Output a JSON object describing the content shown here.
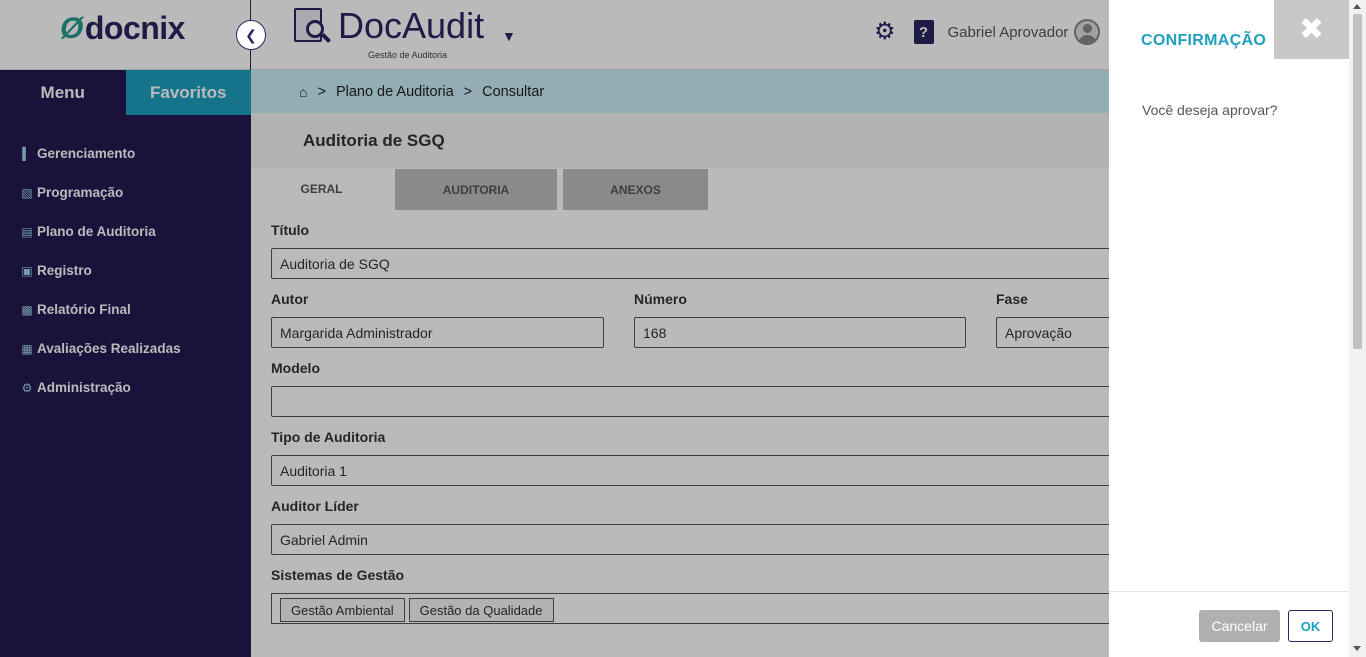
{
  "header": {
    "logo_text": "docnix",
    "app_name": "DocAudit",
    "app_subtitle": "Gestão de Auditoria",
    "user_name": "Gabriel Aprovador"
  },
  "sidebar": {
    "tabs": [
      {
        "label": "Menu"
      },
      {
        "label": "Favoritos"
      }
    ],
    "items": [
      {
        "label": "Gerenciamento",
        "icon": "bar-chart-icon"
      },
      {
        "label": "Programação",
        "icon": "calendar-icon"
      },
      {
        "label": "Plano de Auditoria",
        "icon": "document-icon"
      },
      {
        "label": "Registro",
        "icon": "register-icon"
      },
      {
        "label": "Relatório Final",
        "icon": "report-icon"
      },
      {
        "label": "Avaliações Realizadas",
        "icon": "evaluation-icon"
      },
      {
        "label": "Administração",
        "icon": "cog-icon"
      }
    ]
  },
  "breadcrumb": {
    "items": [
      "Plano de Auditoria",
      "Consultar"
    ],
    "separator": ">"
  },
  "page": {
    "title": "Auditoria de SGQ",
    "tabs": [
      "GERAL",
      "AUDITORIA",
      "ANEXOS"
    ]
  },
  "form": {
    "titulo_label": "Título",
    "titulo_value": "Auditoria de SGQ",
    "autor_label": "Autor",
    "autor_value": "Margarida Administrador",
    "numero_label": "Número",
    "numero_value": "168",
    "fase_label": "Fase",
    "fase_value": "Aprovação",
    "modelo_label": "Modelo",
    "modelo_value": "",
    "tipo_label": "Tipo de Auditoria",
    "tipo_value": "Auditoria 1",
    "lider_label": "Auditor Líder",
    "lider_value": "Gabriel Admin",
    "sistemas_label": "Sistemas de Gestão",
    "sistemas_tags": [
      "Gestão Ambiental",
      "Gestão da Qualidade"
    ]
  },
  "dialog": {
    "title": "CONFIRMAÇÃO",
    "message": "Você deseja aprovar?",
    "cancel_label": "Cancelar",
    "ok_label": "OK"
  },
  "colors": {
    "brand_dark": "#241a52",
    "accent": "#1e9fbf",
    "breadcrumb_bg": "#c9eef7"
  }
}
